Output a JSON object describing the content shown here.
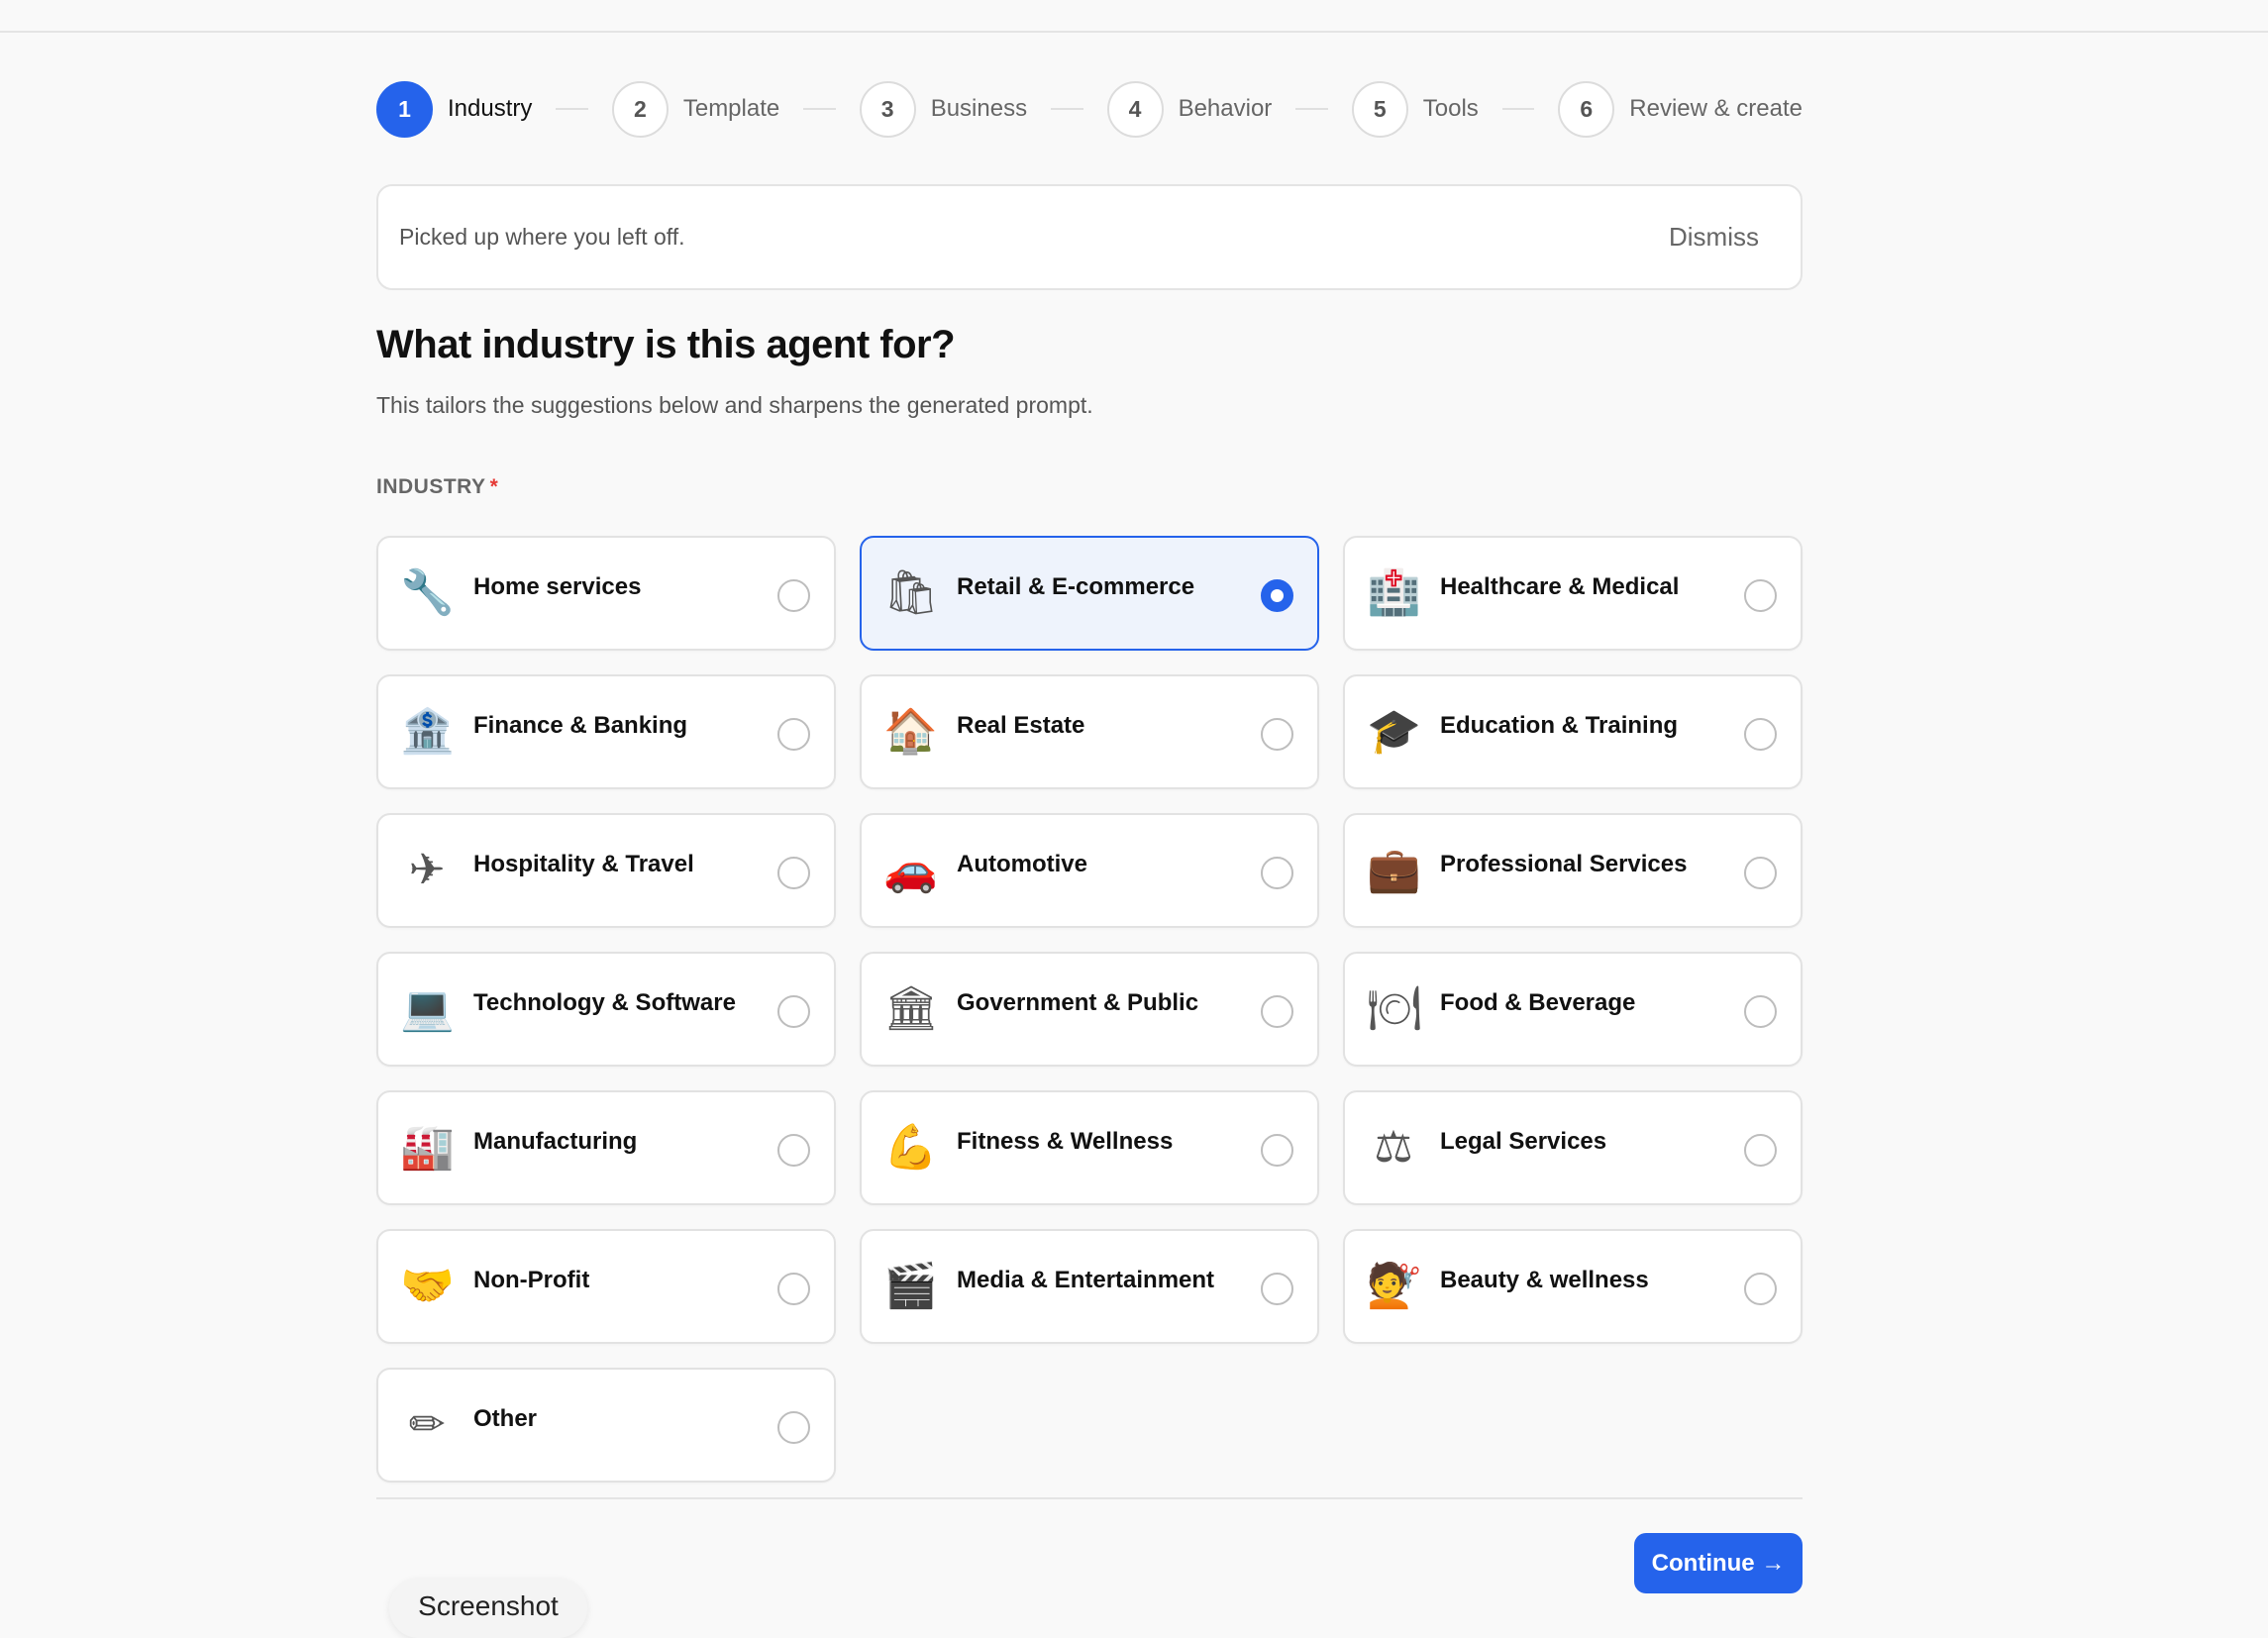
{
  "stepper": {
    "steps": [
      {
        "number": "1",
        "label": "Industry",
        "active": true
      },
      {
        "number": "2",
        "label": "Template",
        "active": false
      },
      {
        "number": "3",
        "label": "Business",
        "active": false
      },
      {
        "number": "4",
        "label": "Behavior",
        "active": false
      },
      {
        "number": "5",
        "label": "Tools",
        "active": false
      },
      {
        "number": "6",
        "label": "Review & create",
        "active": false
      }
    ]
  },
  "banner": {
    "text": "Picked up where you left off.",
    "dismiss_label": "Dismiss"
  },
  "main": {
    "heading": "What industry is this agent for?",
    "subtext": "This tailors the suggestions below and sharpens the generated prompt.",
    "field_label": "INDUSTRY",
    "required_marker": "*"
  },
  "industries": [
    {
      "label": "Home services",
      "icon": "wrench-icon",
      "glyph": "🔧",
      "selected": false
    },
    {
      "label": "Retail & E-commerce",
      "icon": "shopping-bags-icon",
      "glyph": "🛍",
      "selected": true
    },
    {
      "label": "Healthcare & Medical",
      "icon": "hospital-icon",
      "glyph": "🏥",
      "selected": false
    },
    {
      "label": "Finance & Banking",
      "icon": "bank-icon",
      "glyph": "🏦",
      "selected": false
    },
    {
      "label": "Real Estate",
      "icon": "house-icon",
      "glyph": "🏠",
      "selected": false
    },
    {
      "label": "Education & Training",
      "icon": "graduation-cap-icon",
      "glyph": "🎓",
      "selected": false
    },
    {
      "label": "Hospitality & Travel",
      "icon": "airplane-icon",
      "glyph": "✈",
      "selected": false
    },
    {
      "label": "Automotive",
      "icon": "car-icon",
      "glyph": "🚗",
      "selected": false
    },
    {
      "label": "Professional Services",
      "icon": "briefcase-icon",
      "glyph": "💼",
      "selected": false
    },
    {
      "label": "Technology & Software",
      "icon": "laptop-icon",
      "glyph": "💻",
      "selected": false
    },
    {
      "label": "Government & Public",
      "icon": "classical-building-icon",
      "glyph": "🏛",
      "selected": false
    },
    {
      "label": "Food & Beverage",
      "icon": "plate-cutlery-icon",
      "glyph": "🍽",
      "selected": false
    },
    {
      "label": "Manufacturing",
      "icon": "factory-icon",
      "glyph": "🏭",
      "selected": false
    },
    {
      "label": "Fitness & Wellness",
      "icon": "flexed-biceps-icon",
      "glyph": "💪",
      "selected": false
    },
    {
      "label": "Legal Services",
      "icon": "balance-scale-icon",
      "glyph": "⚖",
      "selected": false
    },
    {
      "label": "Non-Profit",
      "icon": "handshake-icon",
      "glyph": "🤝",
      "selected": false
    },
    {
      "label": "Media & Entertainment",
      "icon": "clapper-board-icon",
      "glyph": "🎬",
      "selected": false
    },
    {
      "label": "Beauty & wellness",
      "icon": "haircut-icon",
      "glyph": "💇",
      "selected": false
    },
    {
      "label": "Other",
      "icon": "pencil-icon",
      "glyph": "✏",
      "selected": false
    }
  ],
  "footer": {
    "continue_label": "Continue →"
  },
  "overlay": {
    "screenshot_label": "Screenshot"
  },
  "colors": {
    "accent": "#2563eb",
    "selected_bg": "#eef3fc",
    "required": "#e53935"
  }
}
